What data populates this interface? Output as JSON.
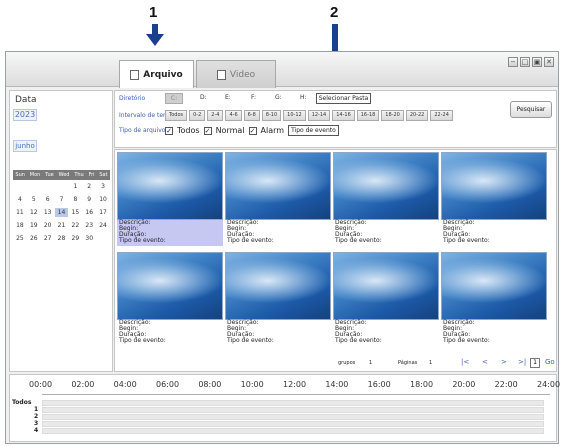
{
  "annotations": [
    {
      "label": "1"
    },
    {
      "label": "2"
    }
  ],
  "tabs": [
    {
      "label": "Arquivo",
      "active": true
    },
    {
      "label": "Video",
      "active": false
    }
  ],
  "window_buttons": [
    "−",
    "□",
    "▣",
    "✕"
  ],
  "left_panel": {
    "title": "Data",
    "year": "2023",
    "month": "junho",
    "calendar": {
      "weekdays": [
        "Sun",
        "Mon",
        "Tue",
        "Wed",
        "Thu",
        "Fri",
        "Sat"
      ],
      "rows": [
        [
          "",
          "",
          "",
          "",
          "1",
          "2",
          "3"
        ],
        [
          "4",
          "5",
          "6",
          "7",
          "8",
          "9",
          "10"
        ],
        [
          "11",
          "12",
          "13",
          "14",
          "15",
          "16",
          "17"
        ],
        [
          "18",
          "19",
          "20",
          "21",
          "22",
          "23",
          "24"
        ],
        [
          "25",
          "26",
          "27",
          "28",
          "29",
          "30",
          ""
        ]
      ],
      "selected_day": "14"
    }
  },
  "filters": {
    "directory_label": "Diretório",
    "drives": [
      "C:",
      "D:",
      "E:",
      "F:",
      "G:",
      "H:"
    ],
    "select_folder": "Selecionar Pasta",
    "interval_label": "Intervalo de tem",
    "intervals": [
      "Todos",
      "0-2",
      "2-4",
      "4-6",
      "6-8",
      "8-10",
      "10-12",
      "12-14",
      "14-16",
      "16-18",
      "18-20",
      "20-22",
      "22-24"
    ],
    "file_type_label": "Tipo de arquivo",
    "types": [
      {
        "label": "Todos",
        "checked": true
      },
      {
        "label": "Normal",
        "checked": true
      },
      {
        "label": "Alarm",
        "checked": true
      }
    ],
    "event_type_button": "Tipo de evento",
    "search_button": "Pesquisar"
  },
  "results": {
    "meta_labels": [
      "Descrição:",
      "Begin:",
      "Duração:",
      "Tipo de evento:"
    ],
    "count": 8,
    "highlighted_index": 0,
    "pager": {
      "grupos_label": "grupos",
      "grupos_value": "1",
      "paginas_label": "Páginas",
      "paginas_value": "1",
      "first": "|<",
      "prev": "<",
      "next": ">",
      "last": ">|",
      "page_input": "1",
      "go": "Go"
    }
  },
  "timeline": {
    "hours": [
      "00:00",
      "02:00",
      "04:00",
      "06:00",
      "08:00",
      "10:00",
      "12:00",
      "14:00",
      "16:00",
      "18:00",
      "20:00",
      "22:00",
      "24:00"
    ],
    "rows": [
      "Todos",
      "1",
      "2",
      "3",
      "4"
    ]
  }
}
